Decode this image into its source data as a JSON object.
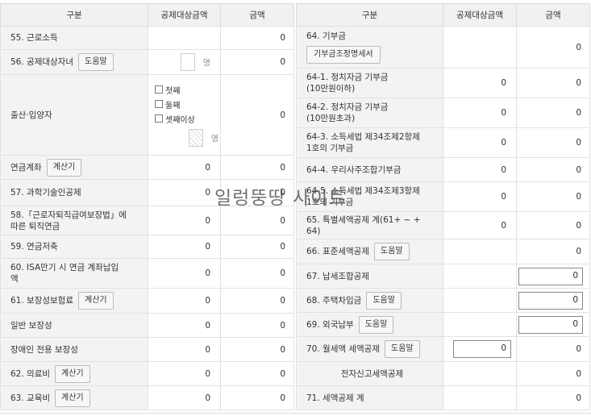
{
  "left": {
    "headers": [
      "구분",
      "공제대상금액",
      "금액"
    ],
    "r55": {
      "label": "55. 근로소득",
      "amount": "0"
    },
    "r56": {
      "label": "56. 공제대상자녀",
      "button": "도움말",
      "unit": "명",
      "amount": "0"
    },
    "birth": {
      "label": "출산·입양자",
      "options": [
        "첫째",
        "둘째",
        "셋째이상"
      ],
      "unit": "명",
      "amount": "0"
    },
    "pension": {
      "label": "연금계좌",
      "button": "계산기",
      "deductible": "0",
      "amount": "0"
    },
    "r57": {
      "label": "57. 과학기술인공제",
      "deductible": "0",
      "amount": "0"
    },
    "r58": {
      "label_line1": "58.「근로자퇴직급여보장법」에",
      "label_line2": "따른 퇴직연금",
      "deductible": "0",
      "amount": "0"
    },
    "r59": {
      "label": "59. 연금저축",
      "deductible": "0",
      "amount": "0"
    },
    "r60": {
      "label_line1": "60. ISA만기 시 연금 계좌납입",
      "label_line2": "액",
      "deductible": "0",
      "amount": "0"
    },
    "r61": {
      "label": "61. 보장성보험료",
      "button": "계산기",
      "deductible": "0",
      "amount": "0"
    },
    "general": {
      "label": "일반 보장성",
      "deductible": "0",
      "amount": "0"
    },
    "disabled": {
      "label": "장애인 전용 보장성",
      "deductible": "0",
      "amount": "0"
    },
    "r62": {
      "label": "62. 의료비",
      "button": "계산기",
      "deductible": "0",
      "amount": "0"
    },
    "r63": {
      "label": "63. 교육비",
      "button": "계산기",
      "deductible": "0",
      "amount": "0"
    }
  },
  "right": {
    "headers": [
      "구분",
      "공제대상금액",
      "금액"
    ],
    "r64": {
      "label": "64. 기부금",
      "button": "기부금조정명세서",
      "amount": "0"
    },
    "r64_1": {
      "label_line1": "64-1. 정치자금 기부금",
      "label_line2": "(10만원이하)",
      "deductible": "0",
      "amount": "0"
    },
    "r64_2": {
      "label_line1": "64-2. 정치자금 기부금",
      "label_line2": "(10만원초과)",
      "deductible": "0",
      "amount": "0"
    },
    "r64_3": {
      "label_line1": "64-3. 소득세법 제34조제2항제",
      "label_line2": "1호의 기부금",
      "deductible": "0",
      "amount": "0"
    },
    "r64_4": {
      "label": "64-4. 우리사주조합기부금",
      "deductible": "0",
      "amount": "0"
    },
    "r64_5": {
      "label_line1": "64-5. 소득세법 제34조제3항제",
      "label_line2": "1호의 기부금",
      "deductible": "0",
      "amount": "0"
    },
    "r65": {
      "label_line1": "65. 특별세액공제 계(61+ ~ +",
      "label_line2": "64)",
      "deductible": "0",
      "amount": "0"
    },
    "r66": {
      "label": "66. 표준세액공제",
      "button": "도움말",
      "amount": "0"
    },
    "r67": {
      "label": "67. 납세조합공제",
      "amount": "0"
    },
    "r68": {
      "label": "68. 주택차입금",
      "button": "도움말",
      "amount": "0"
    },
    "r69": {
      "label": "69. 외국납부",
      "button": "도움말",
      "amount": "0"
    },
    "r70": {
      "label": "70. 월세액 세액공제",
      "button": "도움말",
      "deductible": "0",
      "amount": "0"
    },
    "efile": {
      "label": "전자신고세액공제",
      "amount": "0"
    },
    "r71": {
      "label": "71. 세액공제 계",
      "amount": "0"
    }
  },
  "watermark": "일렁뚱땅 사이트"
}
